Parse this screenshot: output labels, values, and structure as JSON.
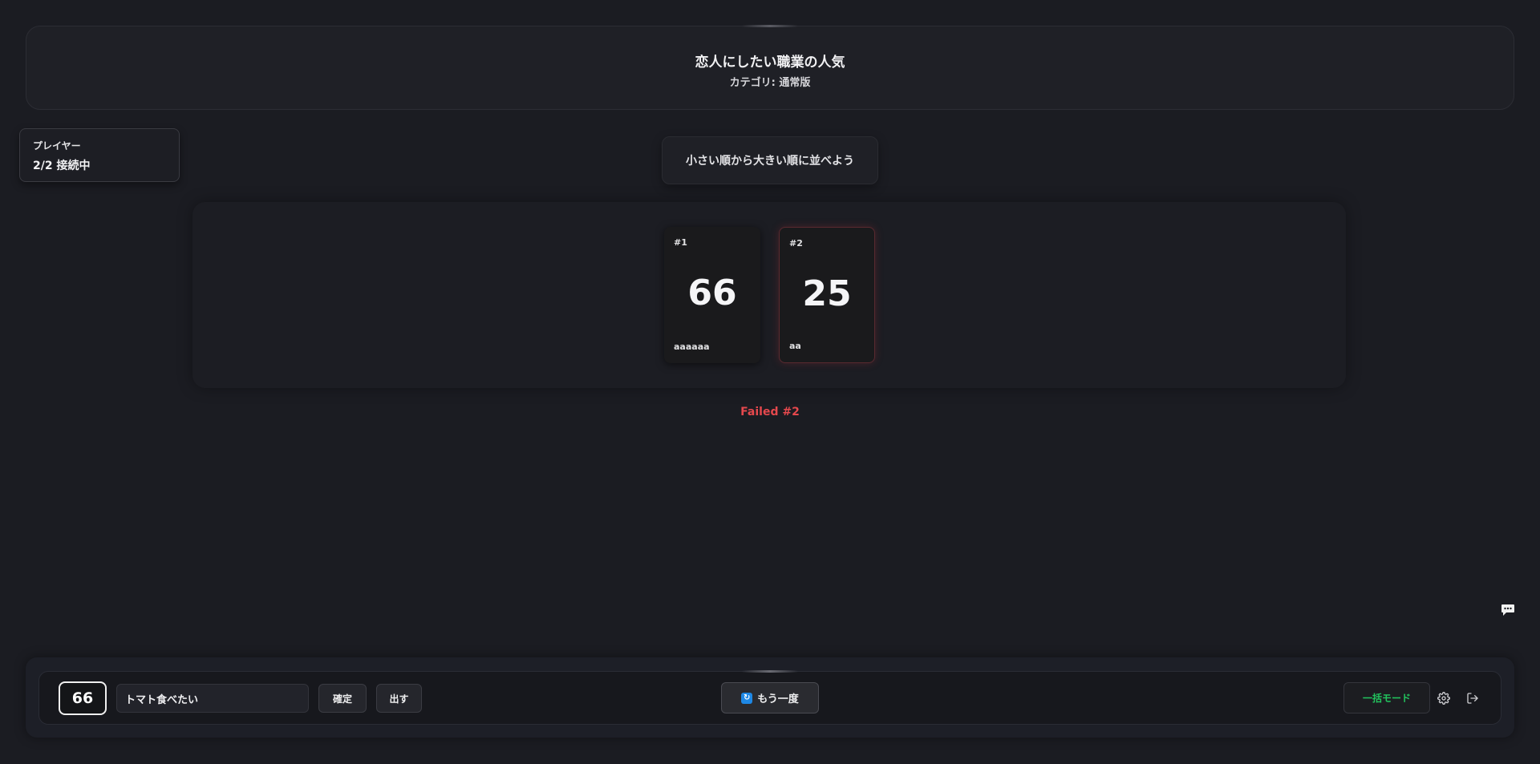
{
  "topic": {
    "title": "恋人にしたい職業の人気",
    "category": "カテゴリ: 通常版"
  },
  "players": {
    "label": "プレイヤー",
    "status": "2/2 接続中"
  },
  "instruction": "小さい順から大きい順に並べよう",
  "cards": [
    {
      "index": "#1",
      "number": "66",
      "name": "aaaaaa",
      "failed": false
    },
    {
      "index": "#2",
      "number": "25",
      "name": "aa",
      "failed": true
    }
  ],
  "result": "Failed #2",
  "bottom_bar": {
    "my_number": "66",
    "hint_value": "トマト食べたい",
    "confirm_label": "確定",
    "play_label": "出す",
    "retry_label": "もう一度",
    "bulk_mode_label": "一括モード"
  },
  "icons": {
    "chat": "chat-bubble-icon",
    "retry": "refresh-icon",
    "settings": "gear-icon",
    "exit": "logout-icon"
  },
  "colors": {
    "background": "#1b1c22",
    "failed_text": "#e5484d",
    "bulk_mode_text": "#22c55e",
    "retry_icon_bg": "#1e88e5"
  }
}
